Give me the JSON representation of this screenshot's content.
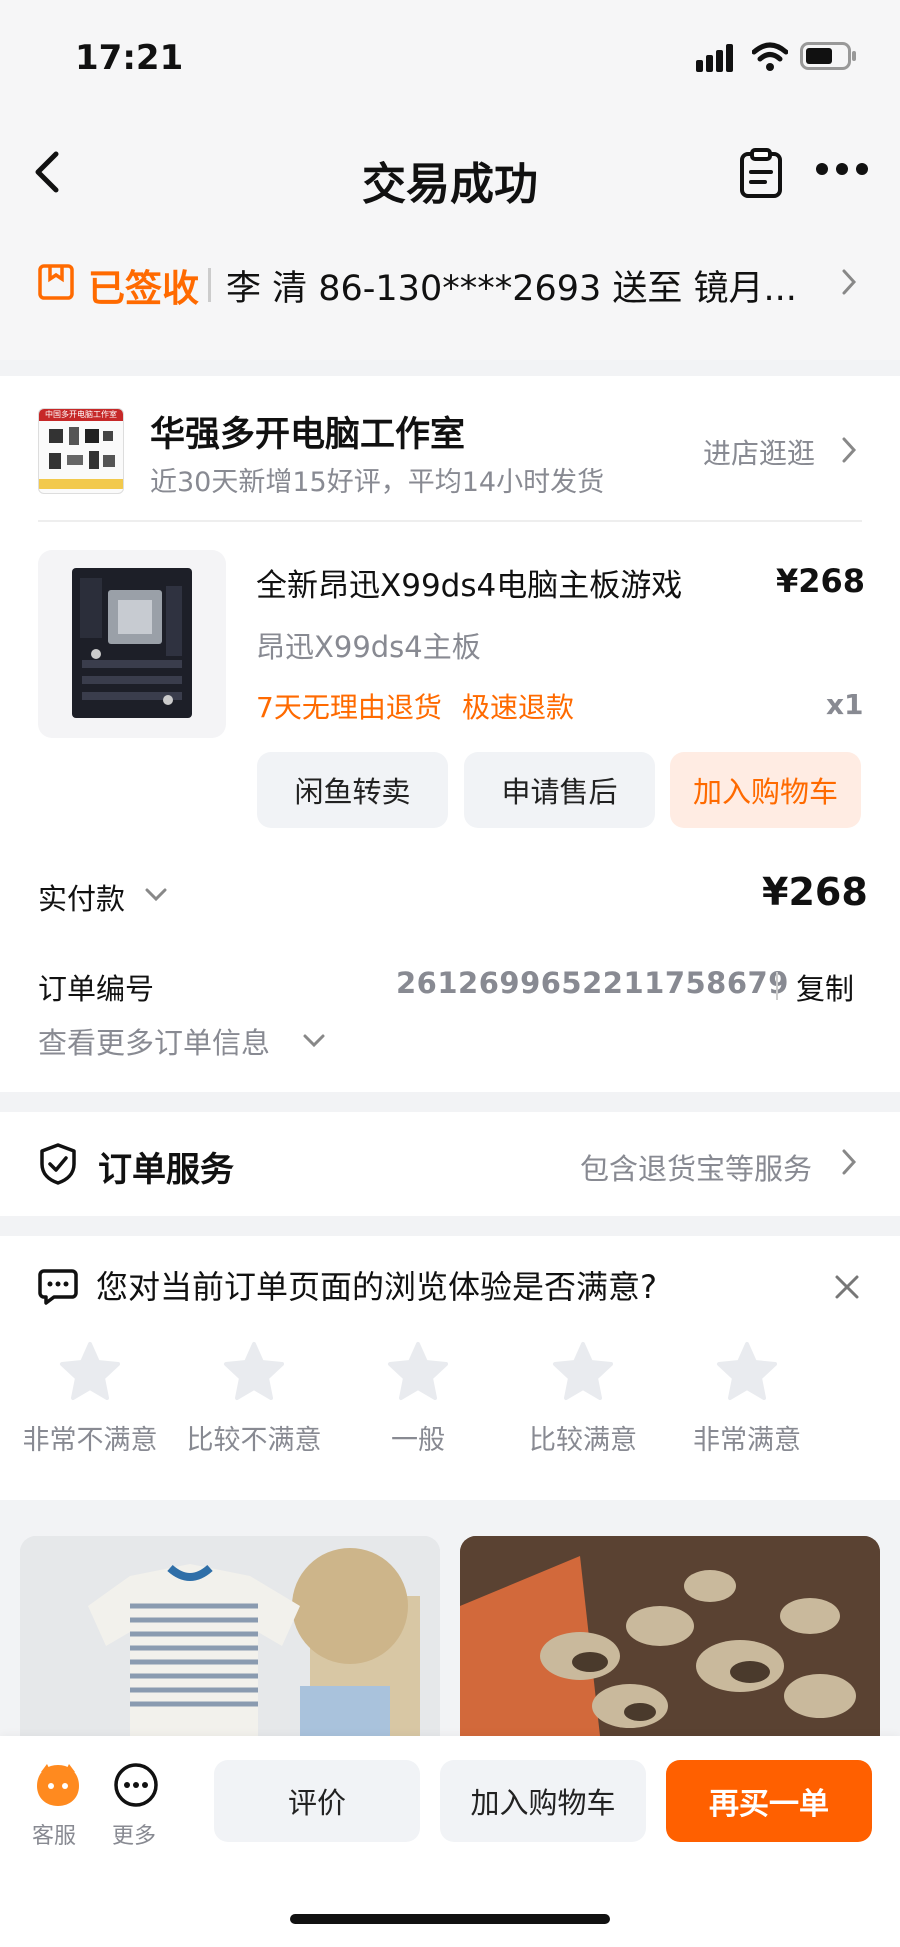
{
  "status_bar": {
    "time": "17:21"
  },
  "nav": {
    "title": "交易成功"
  },
  "delivery": {
    "status": "已签收",
    "recipient": "李 清 86-130****2693 送至 镜月..."
  },
  "shop": {
    "name": "华强多开电脑工作室",
    "stats": "近30天新增15好评，平均14小时发货",
    "visit_label": "进店逛逛",
    "logo_text": "中国多开电脑工作室"
  },
  "product": {
    "title": "全新昂迅X99ds4电脑主板游戏",
    "price": "¥268",
    "spec": "昂迅X99ds4主板",
    "tag1": "7天无理由退货",
    "tag2": "极速退款",
    "qty": "x1",
    "buttons": {
      "resell": "闲鱼转卖",
      "after_sale": "申请售后",
      "add_cart": "加入购物车"
    }
  },
  "payment": {
    "label": "实付款",
    "amount": "¥268"
  },
  "order": {
    "number_label": "订单编号",
    "number": "2612699652211758679",
    "copy_label": "复制",
    "more_info": "查看更多订单信息"
  },
  "service": {
    "title": "订单服务",
    "desc": "包含退货宝等服务"
  },
  "survey": {
    "question": "您对当前订单页面的浏览体验是否满意?",
    "options": [
      "非常不满意",
      "比较不满意",
      "一般",
      "比较满意",
      "非常满意"
    ]
  },
  "bottom_bar": {
    "service_label": "客服",
    "more_label": "更多",
    "review": "评价",
    "add_cart": "加入购物车",
    "buy_again": "再买一单"
  },
  "colors": {
    "accent": "#ff6a00",
    "accent_light": "#ffece3",
    "button_bg": "#f1f3f6",
    "grey_text": "#888a92"
  }
}
